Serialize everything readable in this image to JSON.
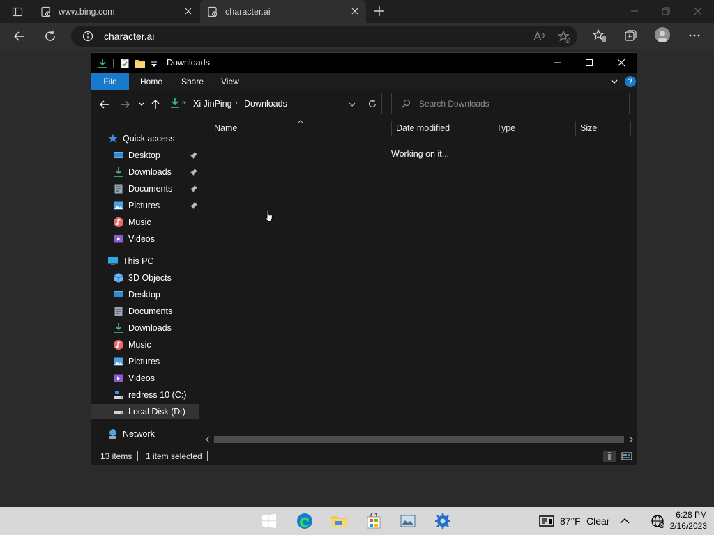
{
  "browser": {
    "tabs": [
      {
        "title": "www.bing.com",
        "active": false
      },
      {
        "title": "character.ai",
        "active": true
      }
    ],
    "address": "character.ai"
  },
  "explorer": {
    "window_title": "Downloads",
    "ribbon_tabs": [
      "File",
      "Home",
      "Share",
      "View"
    ],
    "help_label": "?",
    "path": {
      "prefix": "«",
      "segments": [
        "Xi JinPing",
        "Downloads"
      ],
      "separator": "›"
    },
    "search_placeholder": "Search Downloads",
    "nav_items": [
      {
        "label": "Quick access",
        "level": 1,
        "icon": "star-icon"
      },
      {
        "label": "Desktop",
        "level": 2,
        "icon": "desktop-icon",
        "pinned": true
      },
      {
        "label": "Downloads",
        "level": 2,
        "icon": "download-icon",
        "pinned": true
      },
      {
        "label": "Documents",
        "level": 2,
        "icon": "documents-icon",
        "pinned": true
      },
      {
        "label": "Pictures",
        "level": 2,
        "icon": "pictures-icon",
        "pinned": true
      },
      {
        "label": "Music",
        "level": 2,
        "icon": "music-icon"
      },
      {
        "label": "Videos",
        "level": 2,
        "icon": "videos-icon"
      },
      {
        "label": "This PC",
        "level": 1,
        "icon": "pc-icon"
      },
      {
        "label": "3D Objects",
        "level": 2,
        "icon": "cube-icon"
      },
      {
        "label": "Desktop",
        "level": 2,
        "icon": "desktop-icon"
      },
      {
        "label": "Documents",
        "level": 2,
        "icon": "documents-icon"
      },
      {
        "label": "Downloads",
        "level": 2,
        "icon": "download-icon"
      },
      {
        "label": "Music",
        "level": 2,
        "icon": "music-icon"
      },
      {
        "label": "Pictures",
        "level": 2,
        "icon": "pictures-icon"
      },
      {
        "label": "Videos",
        "level": 2,
        "icon": "videos-icon"
      },
      {
        "label": "redress 10 (C:)",
        "level": 2,
        "icon": "drive-c-icon"
      },
      {
        "label": "Local Disk (D:)",
        "level": 2,
        "icon": "drive-icon",
        "selected": true
      },
      {
        "label": "Network",
        "level": 1,
        "icon": "network-icon"
      }
    ],
    "columns": [
      "Name",
      "Date modified",
      "Type",
      "Size"
    ],
    "working_text": "Working on it...",
    "status": {
      "items": "13 items",
      "selected": "1 item selected"
    }
  },
  "taskbar": {
    "weather": {
      "temp": "87°F",
      "condition": "Clear"
    },
    "time": "6:28 PM",
    "date": "2/16/2023"
  },
  "colors": {
    "accent": "#1979ca",
    "download_green": "#3fbf7f",
    "folder_yellow": "#f2c94c"
  }
}
